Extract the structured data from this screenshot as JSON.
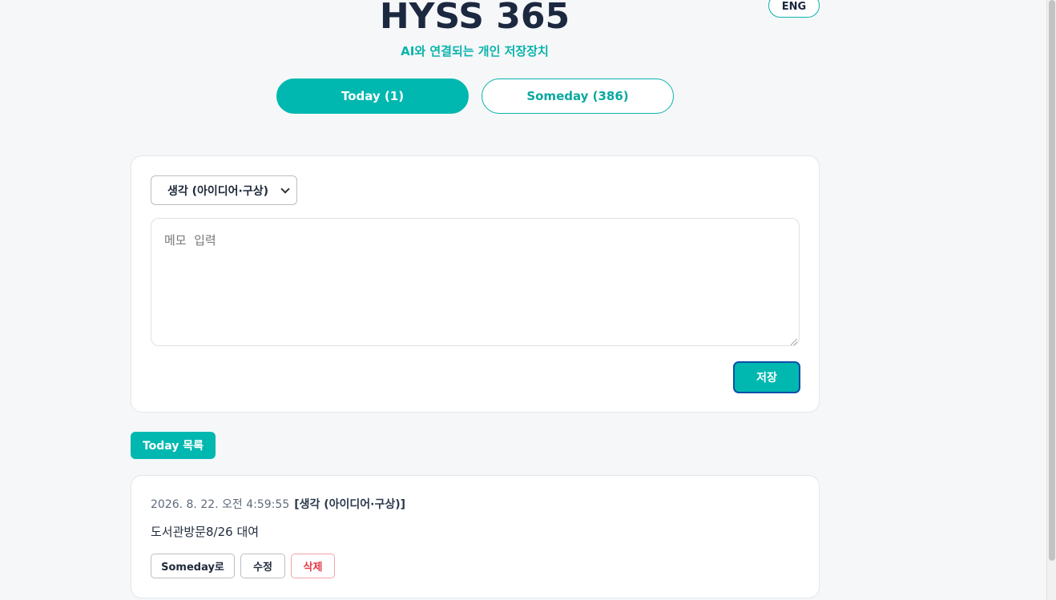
{
  "header": {
    "title": "HYSS 365",
    "subtitle": "AI와 연결되는 개인 저장장치",
    "lang_button": "ENG"
  },
  "tabs": [
    {
      "label": "Today (1)",
      "active": true
    },
    {
      "label": "Someday (386)",
      "active": false
    }
  ],
  "form": {
    "category_selected": "생각 (아이디어·구상)",
    "memo_placeholder": "메모  입력",
    "memo_value": "",
    "save_label": "저장"
  },
  "list": {
    "badge": "Today 목록",
    "entries": [
      {
        "timestamp": "2026. 8. 22. 오전 4:59:55",
        "category": "[생각 (아이디어·구상)]",
        "text": "도서관방문8/26 대여",
        "actions": {
          "someday": "Someday로",
          "edit": "수정",
          "delete": "삭제"
        }
      }
    ]
  },
  "colors": {
    "accent": "#00b8b0",
    "title": "#1c2840",
    "delete": "#e53945"
  }
}
